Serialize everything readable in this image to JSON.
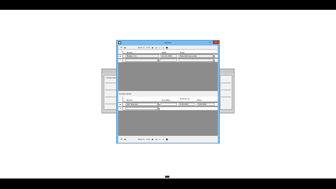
{
  "window": {
    "title": "Master"
  },
  "nav": {
    "label": "Item 1",
    "count": "of 1"
  },
  "grid": {
    "columns": [
      "Name",
      "Date",
      "Type"
    ],
    "rows": [
      {
        "marker": "▸",
        "name": "Master 1.0",
        "date": "01.01.2020",
        "type": "Hauptkomponente"
      },
      {
        "marker": "*",
        "name": "",
        "date": "",
        "type": ""
      }
    ]
  },
  "subsection": {
    "label": "Components"
  },
  "subgrid": {
    "columns": [
      "Name",
      "Quantity",
      "Unit price",
      "Total"
    ],
    "rows": [
      {
        "marker": "▸",
        "name": "Part Number",
        "qty": "",
        "unit": "0.00 EUR",
        "total": "0.00 EUR"
      },
      {
        "marker": "*",
        "name": "",
        "qty": "",
        "unit": "",
        "total": ""
      }
    ]
  },
  "bottomnav": {
    "label": "Item 1",
    "count": "of 1"
  },
  "bgwin": {
    "title": "Components"
  },
  "colors": {
    "titlebar": "#7dbbe8",
    "close": "#c8352b",
    "grid_bg": "#8c8c8c"
  }
}
